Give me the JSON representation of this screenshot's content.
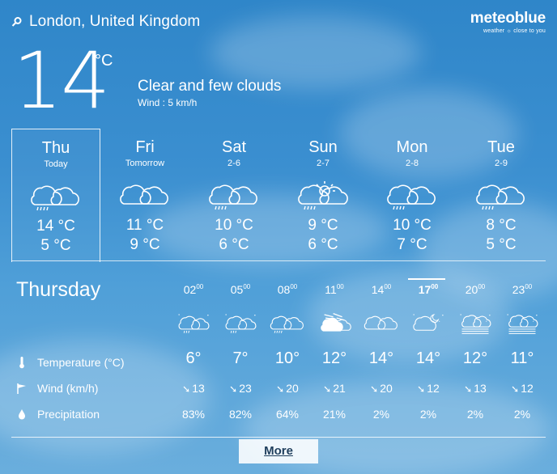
{
  "header": {
    "location": "London, United Kingdom",
    "brand": "meteoblue",
    "brand_tagline": "weather ☼ close to you"
  },
  "current": {
    "temperature": "14",
    "unit": "°C",
    "description": "Clear and few clouds",
    "wind": "Wind : 5 km/h"
  },
  "days": [
    {
      "name": "Thu",
      "sub": "Today",
      "max": "14 °C",
      "min": "5 °C",
      "icon": "cloud-rain-icon",
      "active": true
    },
    {
      "name": "Fri",
      "sub": "Tomorrow",
      "max": "11 °C",
      "min": "9 °C",
      "icon": "cloud-icon",
      "active": false
    },
    {
      "name": "Sat",
      "sub": "2-6",
      "max": "10 °C",
      "min": "6 °C",
      "icon": "cloud-rain-icon",
      "active": false
    },
    {
      "name": "Sun",
      "sub": "2-7",
      "max": "9 °C",
      "min": "6 °C",
      "icon": "sun-cloud-rain-icon",
      "active": false
    },
    {
      "name": "Mon",
      "sub": "2-8",
      "max": "10 °C",
      "min": "7 °C",
      "icon": "cloud-rain-icon",
      "active": false
    },
    {
      "name": "Tue",
      "sub": "2-9",
      "max": "8 °C",
      "min": "5 °C",
      "icon": "cloud-rain-icon",
      "active": false
    }
  ],
  "hourly": {
    "title": "Thursday",
    "labels": {
      "temperature": "Temperature (°C)",
      "wind": "Wind (km/h)",
      "precipitation": "Precipitation"
    },
    "hours": [
      {
        "hour": "02",
        "min": "00",
        "temp": "6°",
        "wind": "13",
        "precip": "83%",
        "icon": "night-cloud-drizzle-icon"
      },
      {
        "hour": "05",
        "min": "00",
        "temp": "7°",
        "wind": "23",
        "precip": "82%",
        "icon": "night-cloud-drizzle-icon"
      },
      {
        "hour": "08",
        "min": "00",
        "temp": "10°",
        "wind": "20",
        "precip": "64%",
        "icon": "cloud-rain-icon"
      },
      {
        "hour": "11",
        "min": "00",
        "temp": "12°",
        "wind": "21",
        "precip": "21%",
        "icon": "sun-cloud-icon"
      },
      {
        "hour": "14",
        "min": "00",
        "temp": "14°",
        "wind": "20",
        "precip": "2%",
        "icon": "cloud-icon"
      },
      {
        "hour": "17",
        "min": "00",
        "temp": "14°",
        "wind": "12",
        "precip": "2%",
        "icon": "night-cloud-icon",
        "current": true
      },
      {
        "hour": "20",
        "min": "00",
        "temp": "12°",
        "wind": "13",
        "precip": "2%",
        "icon": "night-fog-icon"
      },
      {
        "hour": "23",
        "min": "00",
        "temp": "11°",
        "wind": "12",
        "precip": "2%",
        "icon": "night-fog-icon"
      }
    ]
  },
  "footer": {
    "more_label": "More"
  }
}
